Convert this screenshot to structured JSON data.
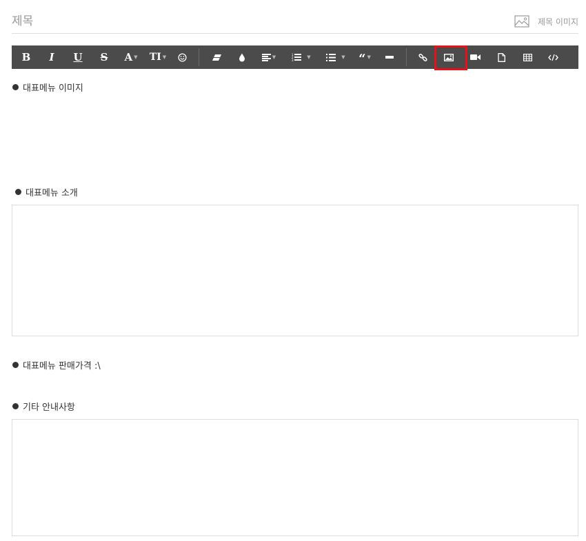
{
  "title": {
    "placeholder": "제목",
    "value": "",
    "image_label": "제목 이미지"
  },
  "toolbar": {
    "highlight_color": "#e0141a",
    "buttons": [
      {
        "name": "bold",
        "label": "B"
      },
      {
        "name": "italic",
        "label": "I"
      },
      {
        "name": "underline",
        "label": "U"
      },
      {
        "name": "strikethrough",
        "label": "S"
      },
      {
        "name": "font-color",
        "label": "A"
      },
      {
        "name": "font-size",
        "label": "TI"
      },
      {
        "name": "emoticon",
        "icon": "smile-icon"
      },
      {
        "name": "eraser",
        "icon": "eraser-icon"
      },
      {
        "name": "background-color",
        "icon": "drop-icon"
      },
      {
        "name": "align",
        "icon": "align-icon"
      },
      {
        "name": "ordered-list",
        "icon": "ordered-list-icon"
      },
      {
        "name": "unordered-list",
        "icon": "unordered-list-icon"
      },
      {
        "name": "quote",
        "icon": "quote-icon"
      },
      {
        "name": "horizontal-rule",
        "icon": "hr-icon"
      },
      {
        "name": "link",
        "icon": "link-icon"
      },
      {
        "name": "image",
        "icon": "image-icon",
        "highlighted": true
      },
      {
        "name": "video",
        "icon": "video-icon"
      },
      {
        "name": "file",
        "icon": "file-icon"
      },
      {
        "name": "table",
        "icon": "table-icon"
      },
      {
        "name": "code",
        "icon": "code-icon"
      }
    ]
  },
  "sections": {
    "menu_image": "대표메뉴 이미지",
    "menu_intro": "대표메뉴 소개",
    "menu_price": "대표메뉴 판매가격 :\\",
    "other_info": "기타 안내사항"
  }
}
